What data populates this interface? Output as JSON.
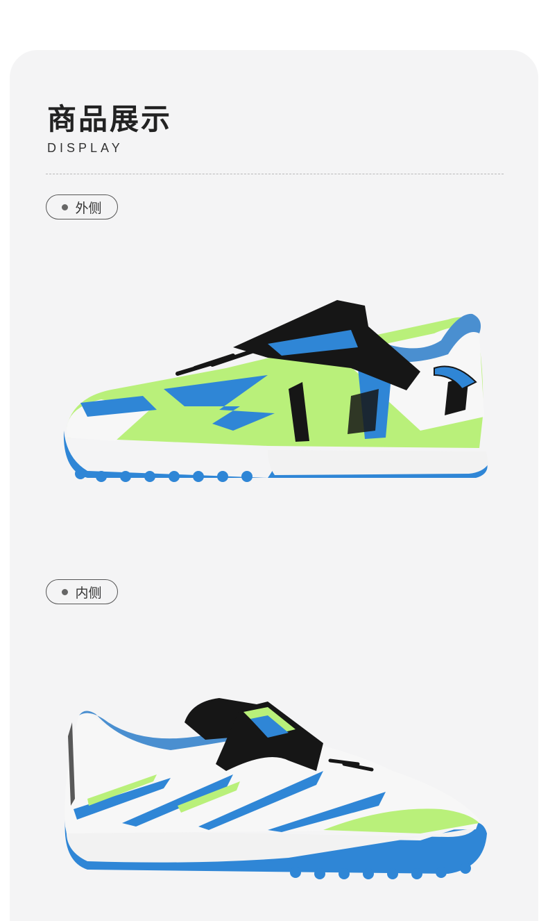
{
  "section": {
    "title": "商品展示",
    "subtitle": "DISPLAY"
  },
  "views": [
    {
      "label": "外侧"
    },
    {
      "label": "内侧"
    }
  ],
  "colors": {
    "card_bg": "#f4f4f5",
    "sole_blue": "#2f86d6",
    "lime": "#b9f07a",
    "strap_black": "#161616",
    "upper_white": "#f7f7f7"
  }
}
